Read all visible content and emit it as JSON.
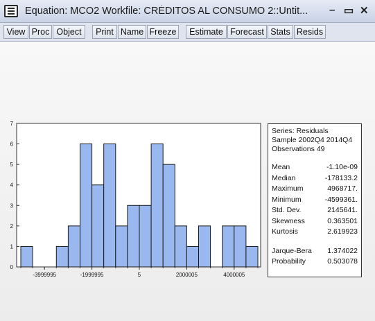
{
  "window": {
    "title": "Equation: MCO2    Workfile: CRÉDITOS AL CONSUMO 2::Untit...",
    "minimize": "–",
    "maximize": "▭",
    "close": "✕"
  },
  "toolbar": {
    "buttons": [
      "View",
      "Proc",
      "Object",
      "Print",
      "Name",
      "Freeze",
      "Estimate",
      "Forecast",
      "Stats",
      "Resids"
    ]
  },
  "colors": {
    "bar_fill": "#9ab8f0",
    "bar_stroke": "#1a1a1a"
  },
  "chart_data": {
    "type": "bar",
    "title": "",
    "xlabel": "",
    "ylabel": "",
    "ylim": [
      0,
      7
    ],
    "y_ticks": [
      "0",
      "1",
      "2",
      "3",
      "4",
      "5",
      "6",
      "7"
    ],
    "x_tick_labels": [
      "-3999995",
      "-1999995",
      "5",
      "2000005",
      "4000005"
    ],
    "bin_width": 500000,
    "bins_start": -5000000,
    "values": [
      1,
      0,
      0,
      1,
      2,
      6,
      4,
      6,
      2,
      3,
      3,
      6,
      5,
      2,
      1,
      2,
      0,
      2,
      2,
      1
    ]
  },
  "stats": {
    "series_label": "Series: Residuals",
    "sample_label": "Sample 2002Q4 2014Q4",
    "observations_label": "Observations 49",
    "rows": [
      {
        "label": "Mean",
        "value": "-1.10e-09"
      },
      {
        "label": "Median",
        "value": "-178133.2"
      },
      {
        "label": "Maximum",
        "value": "4968717."
      },
      {
        "label": "Minimum",
        "value": "-4599361."
      },
      {
        "label": "Std. Dev.",
        "value": "2145641."
      },
      {
        "label": "Skewness",
        "value": "0.363501"
      },
      {
        "label": "Kurtosis",
        "value": "2.619923"
      }
    ],
    "jb_rows": [
      {
        "label": "Jarque-Bera",
        "value": "1.374022"
      },
      {
        "label": "Probability",
        "value": "0.503078"
      }
    ]
  }
}
